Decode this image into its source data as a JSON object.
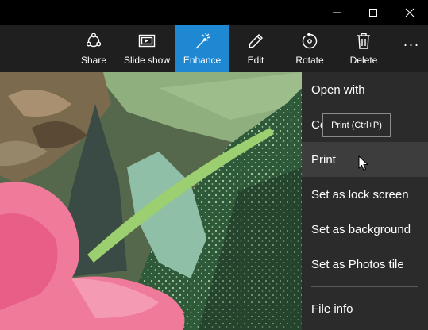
{
  "window": {
    "minimize_icon": "minimize-icon",
    "maximize_icon": "maximize-icon",
    "close_icon": "close-icon"
  },
  "toolbar": {
    "items": [
      {
        "label": "Share",
        "icon": "share-icon"
      },
      {
        "label": "Slide show",
        "icon": "slideshow-icon"
      },
      {
        "label": "Enhance",
        "icon": "enhance-wand-icon",
        "active": true
      },
      {
        "label": "Edit",
        "icon": "pencil-icon"
      },
      {
        "label": "Rotate",
        "icon": "rotate-icon"
      },
      {
        "label": "Delete",
        "icon": "trash-icon"
      }
    ],
    "more": "···",
    "accent_color": "#1e88d2"
  },
  "menu": {
    "items": [
      {
        "label": "Open with"
      },
      {
        "label": "Co"
      },
      {
        "label": "Print",
        "hovered": true
      },
      {
        "label": "Set as lock screen"
      },
      {
        "label": "Set as background"
      },
      {
        "label": "Set as Photos tile"
      },
      {
        "label": "File info"
      }
    ]
  },
  "tooltip": {
    "text": "Print (Ctrl+P)"
  }
}
